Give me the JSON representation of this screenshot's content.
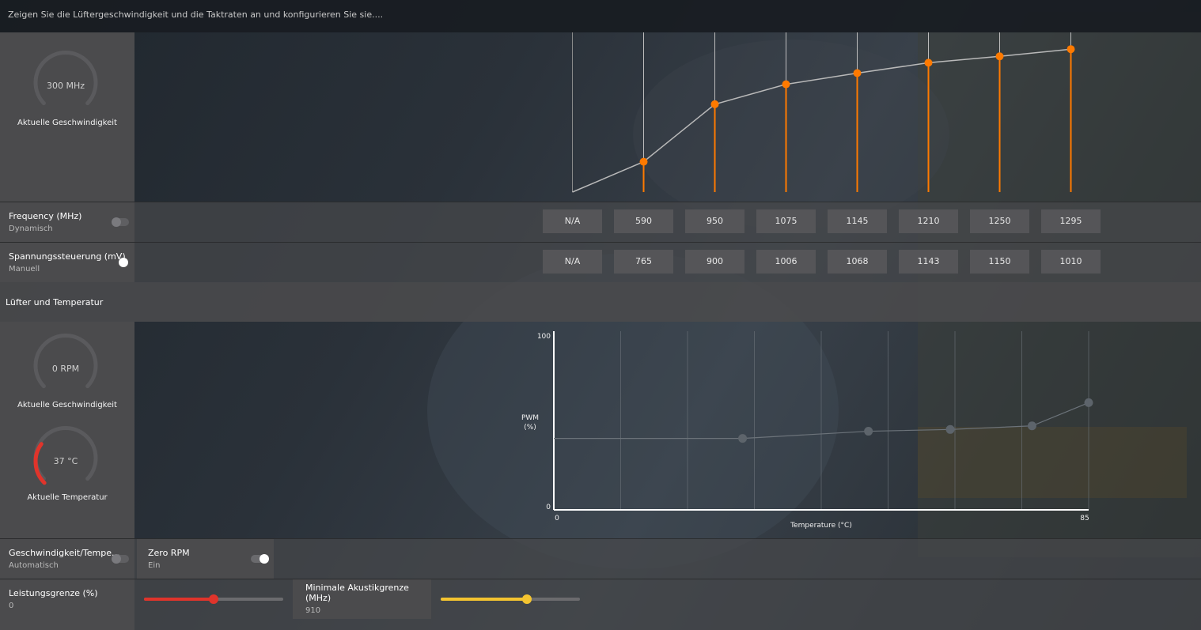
{
  "header": {
    "title": "Zeigen Sie die Lüftergeschwindigkeit und die Taktraten an und konfigurieren Sie sie...."
  },
  "clock": {
    "gauge_value": "300 MHz",
    "gauge_label": "Aktuelle Geschwindigkeit",
    "gauge_fraction": 0
  },
  "frequency": {
    "title": "Frequency (MHz)",
    "mode": "Dynamisch",
    "toggle_on": false,
    "values": [
      "N/A",
      "590",
      "950",
      "1075",
      "1145",
      "1210",
      "1250",
      "1295"
    ]
  },
  "voltage": {
    "title": "Spannungssteuerung (mV)",
    "mode": "Manuell",
    "toggle_on": true,
    "values": [
      "N/A",
      "765",
      "900",
      "1006",
      "1068",
      "1143",
      "1150",
      "1010"
    ]
  },
  "fan_section": {
    "title": "Lüfter und Temperatur"
  },
  "fan_gauge": {
    "value": "0 RPM",
    "label": "Aktuelle Geschwindigkeit",
    "fraction": 0
  },
  "temp_gauge": {
    "value": "37 °C",
    "label": "Aktuelle Temperatur",
    "fraction": 0.3,
    "color": "#e0342b"
  },
  "fan_mode": {
    "title": "Geschwindigkeit/Tempe...",
    "mode": "Automatisch",
    "toggle_on": false
  },
  "zero_rpm": {
    "title": "Zero RPM",
    "state": "Ein",
    "toggle_on": true
  },
  "power_limit": {
    "title": "Leistungsgrenze (%)",
    "value": "0",
    "slider_fraction": 0.5,
    "color": "#e0342b"
  },
  "acoustic_limit": {
    "title": "Minimale Akustikgrenze (MHz)",
    "value": "910",
    "slider_fraction": 0.62,
    "color": "#f4c430"
  },
  "colors": {
    "accent": "#ff7a00",
    "line": "#b9b9b9"
  },
  "chart_data": [
    {
      "type": "line",
      "title": "",
      "x": [
        1,
        2,
        3,
        4,
        5,
        6,
        7,
        8
      ],
      "series": [
        {
          "name": "",
          "values": [
            null,
            590,
            950,
            1075,
            1145,
            1210,
            1250,
            1295
          ]
        }
      ],
      "ylim": [
        400,
        1400
      ],
      "grid": true
    },
    {
      "type": "line",
      "title": "",
      "xlabel": "Temperature (°C)",
      "ylabel": "PWM\n(%)",
      "x_ticks": [
        "0",
        "85"
      ],
      "y_ticks": [
        "0",
        "100"
      ],
      "xlim": [
        0,
        85
      ],
      "ylim": [
        0,
        100
      ],
      "grid": true,
      "series": [
        {
          "name": "",
          "x": [
            30,
            50,
            63,
            76,
            85
          ],
          "y": [
            40,
            44,
            45,
            47,
            60
          ]
        }
      ]
    }
  ]
}
